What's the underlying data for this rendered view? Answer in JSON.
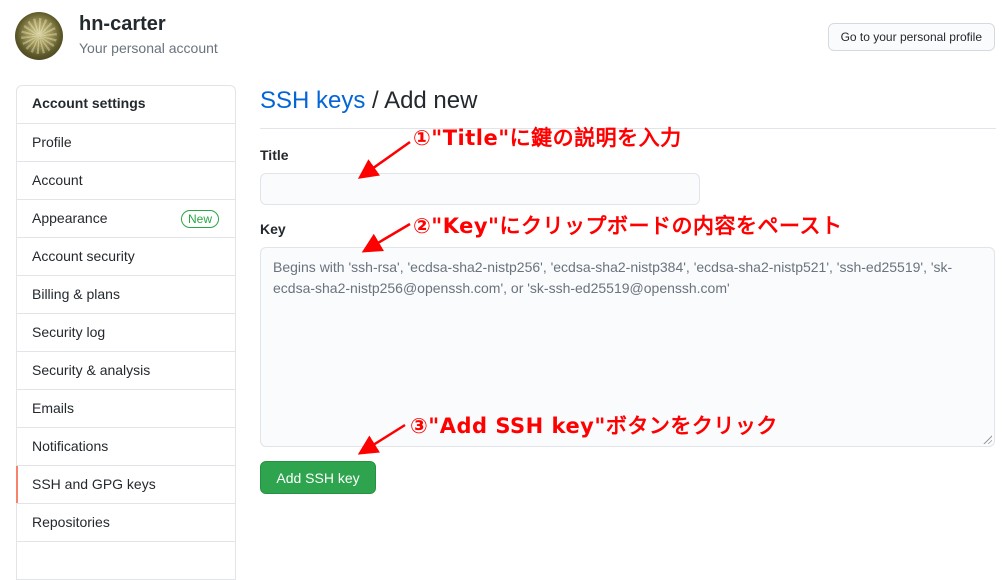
{
  "header": {
    "account_name": "hn-carter",
    "account_subtitle": "Your personal account",
    "profile_button": "Go to your personal profile"
  },
  "sidebar": {
    "heading": "Account settings",
    "items": [
      {
        "label": "Profile"
      },
      {
        "label": "Account"
      },
      {
        "label": "Appearance",
        "badge": "New"
      },
      {
        "label": "Account security"
      },
      {
        "label": "Billing & plans"
      },
      {
        "label": "Security log"
      },
      {
        "label": "Security & analysis"
      },
      {
        "label": "Emails"
      },
      {
        "label": "Notifications"
      },
      {
        "label": "SSH and GPG keys",
        "selected": true
      },
      {
        "label": "Repositories"
      }
    ],
    "selected_color": "#f9826c"
  },
  "main": {
    "breadcrumb": {
      "link": "SSH keys",
      "separator": " / ",
      "current": "Add new"
    },
    "title_label": "Title",
    "title_value": "",
    "key_label": "Key",
    "key_value": "",
    "key_placeholder": "Begins with 'ssh-rsa', 'ecdsa-sha2-nistp256', 'ecdsa-sha2-nistp384', 'ecdsa-sha2-nistp521', 'ssh-ed25519', 'sk-ecdsa-sha2-nistp256@openssh.com', or 'sk-ssh-ed25519@openssh.com'",
    "submit_button": "Add SSH key",
    "submit_color": "#2ea44f",
    "link_color": "#0366d6"
  },
  "annotations": [
    {
      "text": "①\"Title\"に鍵の説明を入力"
    },
    {
      "text": "②\"Key\"にクリップボードの内容をペースト"
    },
    {
      "text": "③\"Add SSH key\"ボタンをクリック"
    }
  ],
  "annotation_color": "#ff0000"
}
